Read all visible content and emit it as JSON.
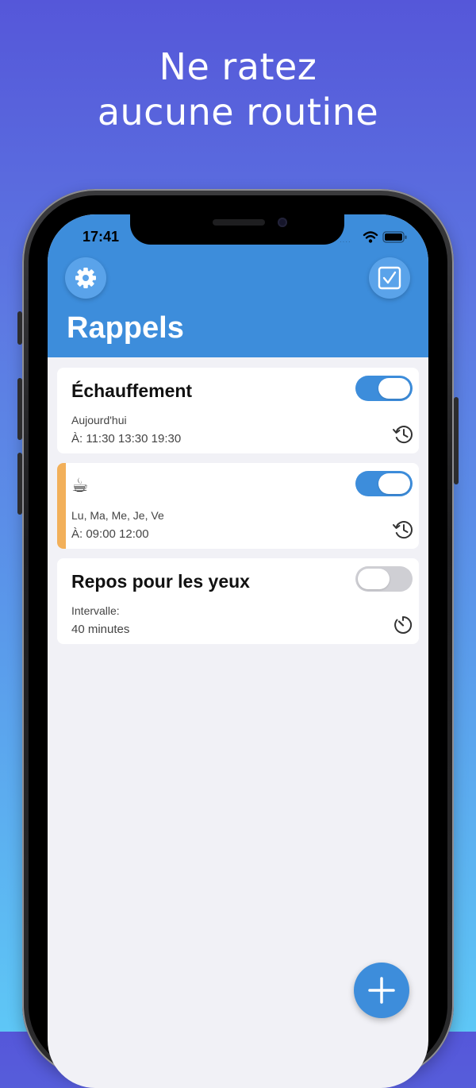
{
  "promo": {
    "headline_line1": "Ne ratez",
    "headline_line2": "aucune routine"
  },
  "status_bar": {
    "time": "17:41",
    "signal_dots": "····"
  },
  "header": {
    "title": "Rappels",
    "settings_icon": "gear-icon",
    "checklist_icon": "checkbox-icon"
  },
  "reminders": [
    {
      "title": "Échauffement",
      "line1": "Aujourd'hui",
      "line2": "À: 11:30 13:30 19:30",
      "enabled": true,
      "icon": "history-clock-icon"
    },
    {
      "emoji": "☕",
      "line1": "Lu, Ma, Me, Je, Ve",
      "line2": "À: 09:00 12:00",
      "enabled": true,
      "accent_color": "#f2b05a",
      "icon": "history-clock-icon"
    },
    {
      "title": "Repos pour les yeux",
      "line1": "Intervalle:",
      "line2": "40 minutes",
      "enabled": false,
      "icon": "timer-icon"
    }
  ],
  "fab": {
    "icon": "plus-icon"
  },
  "colors": {
    "accent": "#3d8ddb",
    "toggle_off": "#cfcfd4",
    "background": "#f1f1f6"
  }
}
